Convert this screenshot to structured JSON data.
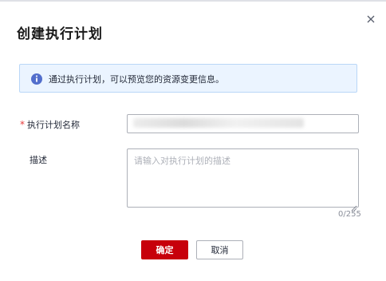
{
  "dialog": {
    "title": "创建执行计划",
    "close_icon": "close-icon",
    "notice": {
      "icon": "info-icon",
      "text": "通过执行计划，可以预览您的资源变更信息。"
    }
  },
  "form": {
    "name": {
      "required_mark": "*",
      "label": "执行计划名称",
      "value": ""
    },
    "description": {
      "label": "描述",
      "placeholder": "请输入对执行计划的描述",
      "counter": "0/255"
    }
  },
  "buttons": {
    "confirm": "确定",
    "cancel": "取消"
  },
  "colors": {
    "primary": "#c7000b",
    "info": "#526ecc",
    "notice_bg": "#ebf4ff",
    "required": "#e63c3c"
  }
}
